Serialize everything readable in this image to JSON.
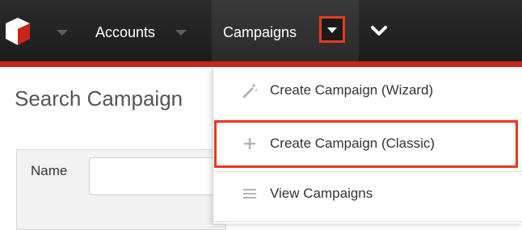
{
  "nav": {
    "accounts_label": "Accounts",
    "campaigns_label": "Campaigns",
    "accent_color": "#e8391f",
    "bar_color": "#1c1c1c",
    "stripe_color": "#c9251b"
  },
  "page": {
    "title": "Search Campaign",
    "search_label": "Name",
    "search_value": ""
  },
  "dropdown": {
    "items": [
      {
        "label": "Create Campaign (Wizard)",
        "icon": "wand-icon"
      },
      {
        "label": "Create Campaign (Classic)",
        "icon": "plus-icon"
      },
      {
        "label": "View Campaigns",
        "icon": "list-icon"
      }
    ]
  }
}
